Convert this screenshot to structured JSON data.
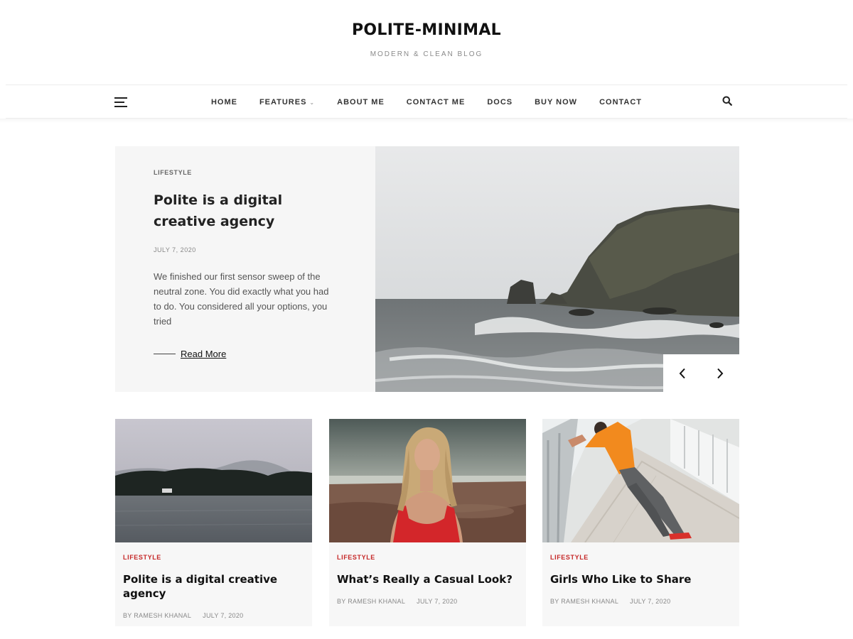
{
  "site": {
    "title": "POLITE-MINIMAL",
    "tagline": "MODERN & CLEAN BLOG"
  },
  "nav": {
    "items": [
      {
        "label": "HOME",
        "has_dropdown": false
      },
      {
        "label": "FEATURES",
        "has_dropdown": true
      },
      {
        "label": "ABOUT ME",
        "has_dropdown": false
      },
      {
        "label": "CONTACT ME",
        "has_dropdown": false
      },
      {
        "label": "DOCS",
        "has_dropdown": false
      },
      {
        "label": "BUY NOW",
        "has_dropdown": false
      },
      {
        "label": "CONTACT",
        "has_dropdown": false
      }
    ],
    "menu_icon": "hamburger-icon",
    "search_icon": "search-icon"
  },
  "featured": {
    "category": "LIFESTYLE",
    "title": "Polite is a digital creative agency",
    "date": "JULY 7, 2020",
    "excerpt": "We finished our first sensor sweep of the neutral zone. You did exactly what you had to do. You considered all your options, you tried",
    "read_more": "Read More",
    "image": "coastal-cliffs-photo",
    "prev_icon": "chevron-left-icon",
    "next_icon": "chevron-right-icon"
  },
  "cards": [
    {
      "category": "LIFESTYLE",
      "title": "Polite is a digital creative agency",
      "author": "BY RAMESH KHANAL",
      "date": "JULY 7, 2020",
      "image": "misty-lake-photo"
    },
    {
      "category": "LIFESTYLE",
      "title": "What’s Really a Casual Look?",
      "author": "BY RAMESH KHANAL",
      "date": "JULY 7, 2020",
      "image": "woman-on-beach-photo"
    },
    {
      "category": "LIFESTYLE",
      "title": "Girls Who Like to Share",
      "author": "BY RAMESH KHANAL",
      "date": "JULY 7, 2020",
      "image": "man-stretching-on-bridge-photo"
    }
  ],
  "colors": {
    "accent_red": "#c62828",
    "panel_bg": "#f6f6f6",
    "text_dark": "#222222"
  }
}
